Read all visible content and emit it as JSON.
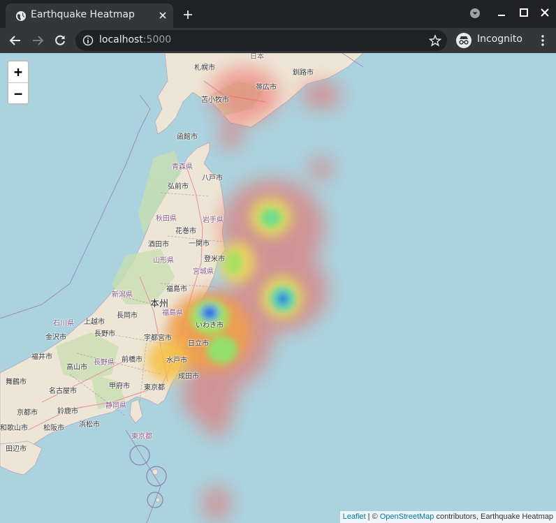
{
  "browser": {
    "tab_title": "Earthquake Heatmap",
    "url_host": "localhost",
    "url_port": ":5000",
    "profile_label": "Incognito"
  },
  "map": {
    "zoom_in_label": "+",
    "zoom_out_label": "−",
    "attribution": {
      "leaflet": "Leaflet",
      "separator": " | © ",
      "osm": "OpenStreetMap",
      "rest": " contributors, Earthquake Heatmap"
    },
    "labels": [
      {
        "text": "日本",
        "kind": "country"
      },
      {
        "text": "札幌市",
        "kind": "city"
      },
      {
        "text": "釧路市",
        "kind": "city"
      },
      {
        "text": "帯広市",
        "kind": "city"
      },
      {
        "text": "苫小牧市",
        "kind": "city"
      },
      {
        "text": "函館市",
        "kind": "city"
      },
      {
        "text": "青森県",
        "kind": "pref"
      },
      {
        "text": "八戸市",
        "kind": "city"
      },
      {
        "text": "弘前市",
        "kind": "city"
      },
      {
        "text": "秋田県",
        "kind": "pref"
      },
      {
        "text": "岩手県",
        "kind": "pref"
      },
      {
        "text": "花巻市",
        "kind": "city"
      },
      {
        "text": "酒田市",
        "kind": "city"
      },
      {
        "text": "一関市",
        "kind": "city"
      },
      {
        "text": "山形県",
        "kind": "pref"
      },
      {
        "text": "登米市",
        "kind": "city"
      },
      {
        "text": "宮城県",
        "kind": "pref"
      },
      {
        "text": "新潟県",
        "kind": "pref"
      },
      {
        "text": "福島市",
        "kind": "city"
      },
      {
        "text": "本州",
        "kind": "big"
      },
      {
        "text": "石川県",
        "kind": "pref"
      },
      {
        "text": "上越市",
        "kind": "city"
      },
      {
        "text": "長岡市",
        "kind": "city"
      },
      {
        "text": "福島県",
        "kind": "pref"
      },
      {
        "text": "いわき市",
        "kind": "city"
      },
      {
        "text": "金沢市",
        "kind": "city"
      },
      {
        "text": "長野市",
        "kind": "city"
      },
      {
        "text": "宇都宮市",
        "kind": "city"
      },
      {
        "text": "日立市",
        "kind": "city"
      },
      {
        "text": "福井市",
        "kind": "city"
      },
      {
        "text": "長野県",
        "kind": "pref"
      },
      {
        "text": "前橋市",
        "kind": "city"
      },
      {
        "text": "水戸市",
        "kind": "city"
      },
      {
        "text": "高山市",
        "kind": "city"
      },
      {
        "text": "舞鶴市",
        "kind": "city"
      },
      {
        "text": "名古屋市",
        "kind": "city"
      },
      {
        "text": "甲府市",
        "kind": "city"
      },
      {
        "text": "成田市",
        "kind": "city"
      },
      {
        "text": "東京都",
        "kind": "city"
      },
      {
        "text": "静岡県",
        "kind": "pref"
      },
      {
        "text": "京都市",
        "kind": "city"
      },
      {
        "text": "鈴鹿市",
        "kind": "city"
      },
      {
        "text": "和歌山市",
        "kind": "city"
      },
      {
        "text": "松阪市",
        "kind": "city"
      },
      {
        "text": "浜松市",
        "kind": "city"
      },
      {
        "text": "東京都",
        "kind": "pref"
      },
      {
        "text": "田辺市",
        "kind": "city"
      }
    ]
  }
}
